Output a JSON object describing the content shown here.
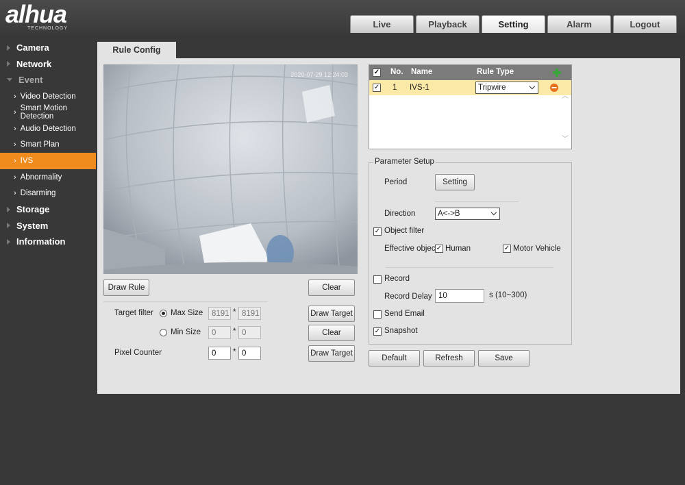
{
  "brand": {
    "name": "alhua",
    "sub": "TECHNOLOGY"
  },
  "topnav": [
    "Live",
    "Playback",
    "Setting",
    "Alarm",
    "Logout"
  ],
  "sidebar": {
    "camera": "Camera",
    "network": "Network",
    "event": "Event",
    "event_items": [
      "Video Detection",
      "Smart Motion Detection",
      "Audio Detection",
      "Smart Plan",
      "IVS",
      "Abnormality",
      "Disarming"
    ],
    "storage": "Storage",
    "system": "System",
    "information": "Information"
  },
  "config_tab": "Rule Config",
  "video": {
    "timestamp": "2020-07-29 12:24:03"
  },
  "left_controls": {
    "draw_rule": "Draw Rule",
    "clear": "Clear",
    "target_filter": "Target filter",
    "max_size": "Max Size",
    "max_w": "8191",
    "max_h": "8191",
    "min_size": "Min Size",
    "min_w": "0",
    "min_h": "0",
    "times": "*",
    "draw_target": "Draw Target",
    "clear2": "Clear",
    "pixel_counter": "Pixel Counter",
    "pix_w": "0",
    "pix_h": "0",
    "draw_target2": "Draw Target"
  },
  "rule_table": {
    "headers": {
      "no": "No.",
      "name": "Name",
      "type": "Rule Type"
    },
    "rows": [
      {
        "no": "1",
        "name": "IVS-1",
        "type": "Tripwire"
      }
    ]
  },
  "params": {
    "legend": "Parameter Setup",
    "period": "Period",
    "setting_btn": "Setting",
    "direction": "Direction",
    "direction_value": "A<->B",
    "object_filter": "Object filter",
    "effective_object": "Effective object",
    "human": "Human",
    "motor_vehicle": "Motor Vehicle",
    "record": "Record",
    "record_delay": "Record Delay",
    "record_delay_value": "10",
    "record_delay_unit": "s (10~300)",
    "send_email": "Send Email",
    "snapshot": "Snapshot"
  },
  "buttons": {
    "default": "Default",
    "refresh": "Refresh",
    "save": "Save"
  },
  "colors": {
    "accent": "#f08b1e",
    "highlight_row": "#fbe9a8",
    "add": "#3aa53a",
    "remove": "#e8711c"
  }
}
